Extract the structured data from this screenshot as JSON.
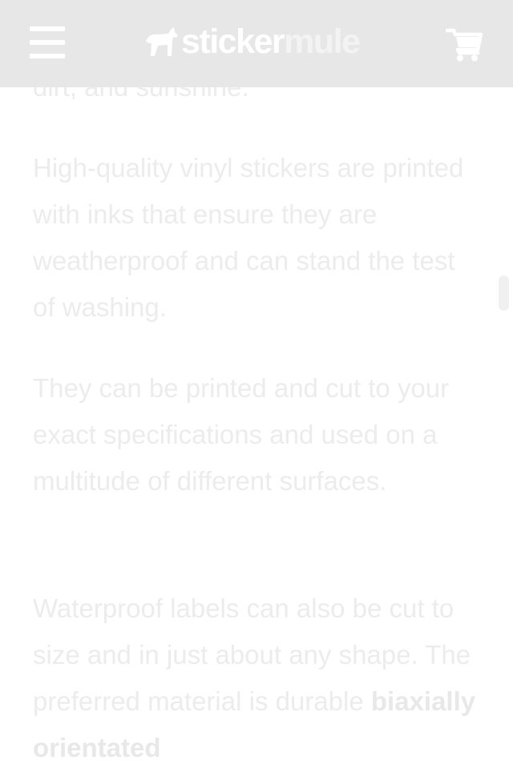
{
  "header": {
    "logo_part1": "sticker",
    "logo_part2": "mule",
    "menu_icon": "hamburger-menu-icon",
    "cart_icon": "shopping-cart-icon",
    "background": "#e7e7e7"
  },
  "article": {
    "clipped_line": "dirt, and sunshine.",
    "paragraphs": [
      "High-quality vinyl stickers are printed with inks that ensure they are weatherproof and can stand the test of washing.",
      "They can be printed and cut to your exact specifications and used on a multitude of different surfaces."
    ],
    "p3_text": "Waterproof labels can also be cut to size and in just about any shape. The preferred material is durable ",
    "p3_bold": "biaxially orientated"
  }
}
